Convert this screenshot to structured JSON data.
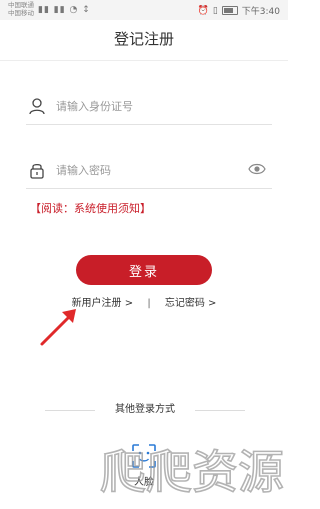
{
  "status_bar": {
    "carrier_1": "中国联通",
    "carrier_2": "中国移动",
    "signal_icons": "▮▮ ▮▮ ◔ ↕",
    "time": "下午3:40"
  },
  "nav": {
    "title": "登记注册"
  },
  "form": {
    "id_field": {
      "placeholder": "请输入身份证号",
      "value": ""
    },
    "password_field": {
      "placeholder": "请输入密码",
      "value": ""
    }
  },
  "notice": "【阅读：系统使用须知】",
  "login_button": "登录",
  "links": {
    "register": "新用户注册 >",
    "separator": "|",
    "forgot": "忘记密码 >"
  },
  "other_login": {
    "title": "其他登录方式",
    "face_label": "人脸"
  },
  "watermark_text": "爬爬资源",
  "colors": {
    "accent": "#c81e28",
    "notice": "#c91e2a",
    "annotation_arrow": "#e0292a"
  }
}
